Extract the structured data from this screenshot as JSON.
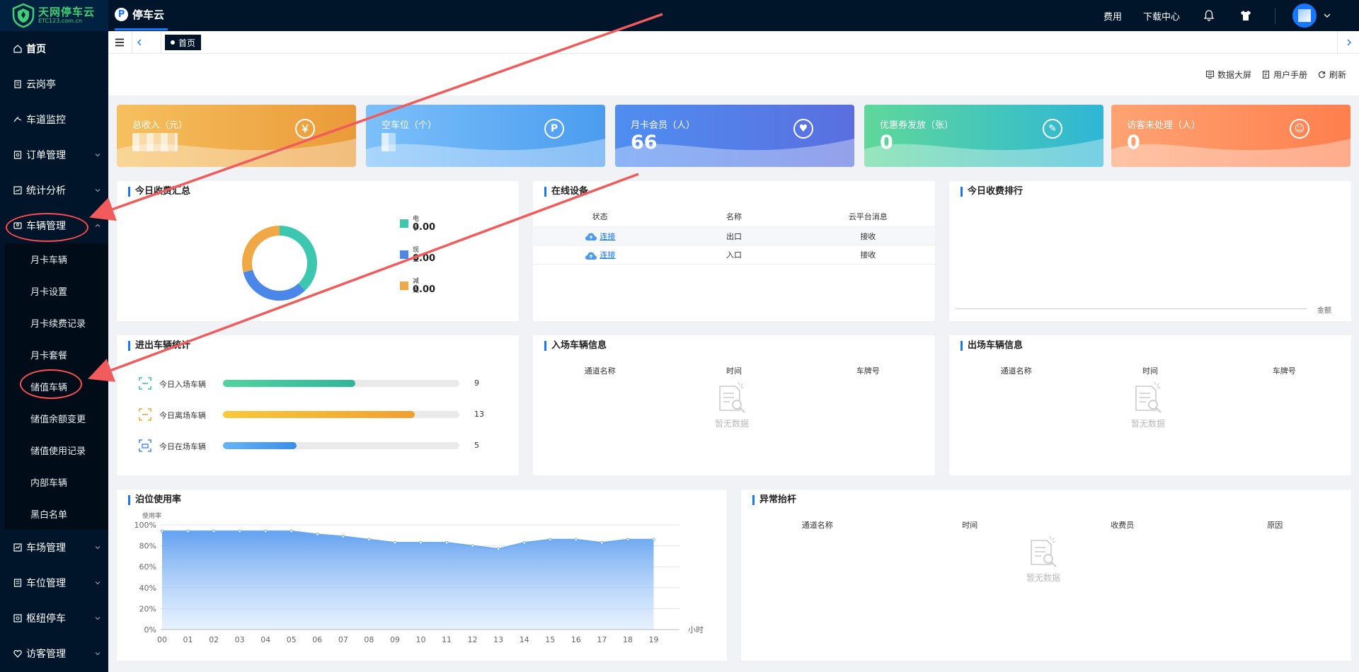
{
  "logo": {
    "main": "天网停车云",
    "sub": "ETC123.com.cn"
  },
  "brand": {
    "badge": "P",
    "title": "停车云"
  },
  "topbar": {
    "fee": "费用",
    "download": "下载中心"
  },
  "sidebar": {
    "home": "首页",
    "top_items": [
      "云岗亭",
      "车道监控",
      "订单管理",
      "统计分析"
    ],
    "vehicle": "车辆管理",
    "sub_items": [
      "月卡车辆",
      "月卡设置",
      "月卡续费记录",
      "月卡套餐",
      "储值车辆",
      "储值余额变更",
      "储值使用记录",
      "内部车辆",
      "黑白名单"
    ],
    "bottom_items": [
      "车场管理",
      "车位管理",
      "枢纽停车",
      "访客管理"
    ]
  },
  "tabs": {
    "active": "首页"
  },
  "actions": {
    "screen": "数据大屏",
    "manual": "用户手册",
    "refresh": "刷新"
  },
  "stats": [
    {
      "label": "总收入（元）",
      "value": "",
      "icon": "￥",
      "color": "#f0a845"
    },
    {
      "label": "空车位（个）",
      "value": "",
      "icon": "P",
      "color": "#58a8f5"
    },
    {
      "label": "月卡会员（人）",
      "value": "66",
      "icon": "♥",
      "color": "#4a7de8"
    },
    {
      "label": "优惠券发放（张）",
      "value": "0",
      "icon": "✎",
      "color": "#3cc7a8"
    },
    {
      "label": "访客未处理（人）",
      "value": "0",
      "icon": "☺",
      "color": "#ff8c5a"
    }
  ],
  "income": {
    "title": "今日收费汇总",
    "legend": [
      {
        "name": "电子",
        "value": "0.00",
        "color": "#3cc7b0"
      },
      {
        "name": "现金",
        "value": "0.00",
        "color": "#4a87e8"
      },
      {
        "name": "减免",
        "value": "0.00",
        "color": "#f0a845"
      }
    ]
  },
  "devices": {
    "title": "在线设备",
    "headers": [
      "状态",
      "名称",
      "云平台消息"
    ],
    "rows": [
      {
        "status": "连接",
        "name": "出口",
        "msg": "接收"
      },
      {
        "status": "连接",
        "name": "入口",
        "msg": "接收"
      }
    ]
  },
  "ranking": {
    "title": "今日收费排行",
    "axis": "金额"
  },
  "flow": {
    "title": "进出车辆统计",
    "rows": [
      {
        "label": "今日入场车辆",
        "value": 9,
        "pct": 0.56,
        "color": "#3cc7a0",
        "icon_color": "#3cc7a0"
      },
      {
        "label": "今日离场车辆",
        "value": 13,
        "pct": 0.81,
        "color": "#f0a830",
        "icon_color": "#f0a830"
      },
      {
        "label": "今日在场车辆",
        "value": 5,
        "pct": 0.31,
        "color": "#4aa0f0",
        "icon_color": "#4a87e8"
      }
    ]
  },
  "entry": {
    "title": "入场车辆信息",
    "headers": [
      "通道名称",
      "时间",
      "车牌号"
    ],
    "empty": "暂无数据"
  },
  "exit": {
    "title": "出场车辆信息",
    "headers": [
      "通道名称",
      "时间",
      "车牌号"
    ],
    "empty": "暂无数据"
  },
  "abnormal": {
    "title": "异常抬杆",
    "headers": [
      "通道名称",
      "时间",
      "收费员",
      "原因"
    ],
    "empty": "暂无数据"
  },
  "chart_data": {
    "type": "area",
    "title": "泊位使用率",
    "ylabel": "使用率",
    "xlabel": "小时",
    "x": [
      "00",
      "01",
      "02",
      "03",
      "04",
      "05",
      "06",
      "07",
      "08",
      "09",
      "10",
      "11",
      "12",
      "13",
      "14",
      "15",
      "16",
      "17",
      "18",
      "19"
    ],
    "y_ticks": [
      "0%",
      "20%",
      "40%",
      "60%",
      "80%",
      "100%"
    ],
    "ylim": [
      0,
      100
    ],
    "series": [
      {
        "values": [
          94,
          94,
          94,
          94,
          94,
          94,
          91,
          89,
          86,
          83,
          83,
          83,
          80,
          77,
          83,
          86,
          86,
          83,
          86,
          86
        ]
      }
    ],
    "color": "#6aaaf0",
    "grid": true
  }
}
